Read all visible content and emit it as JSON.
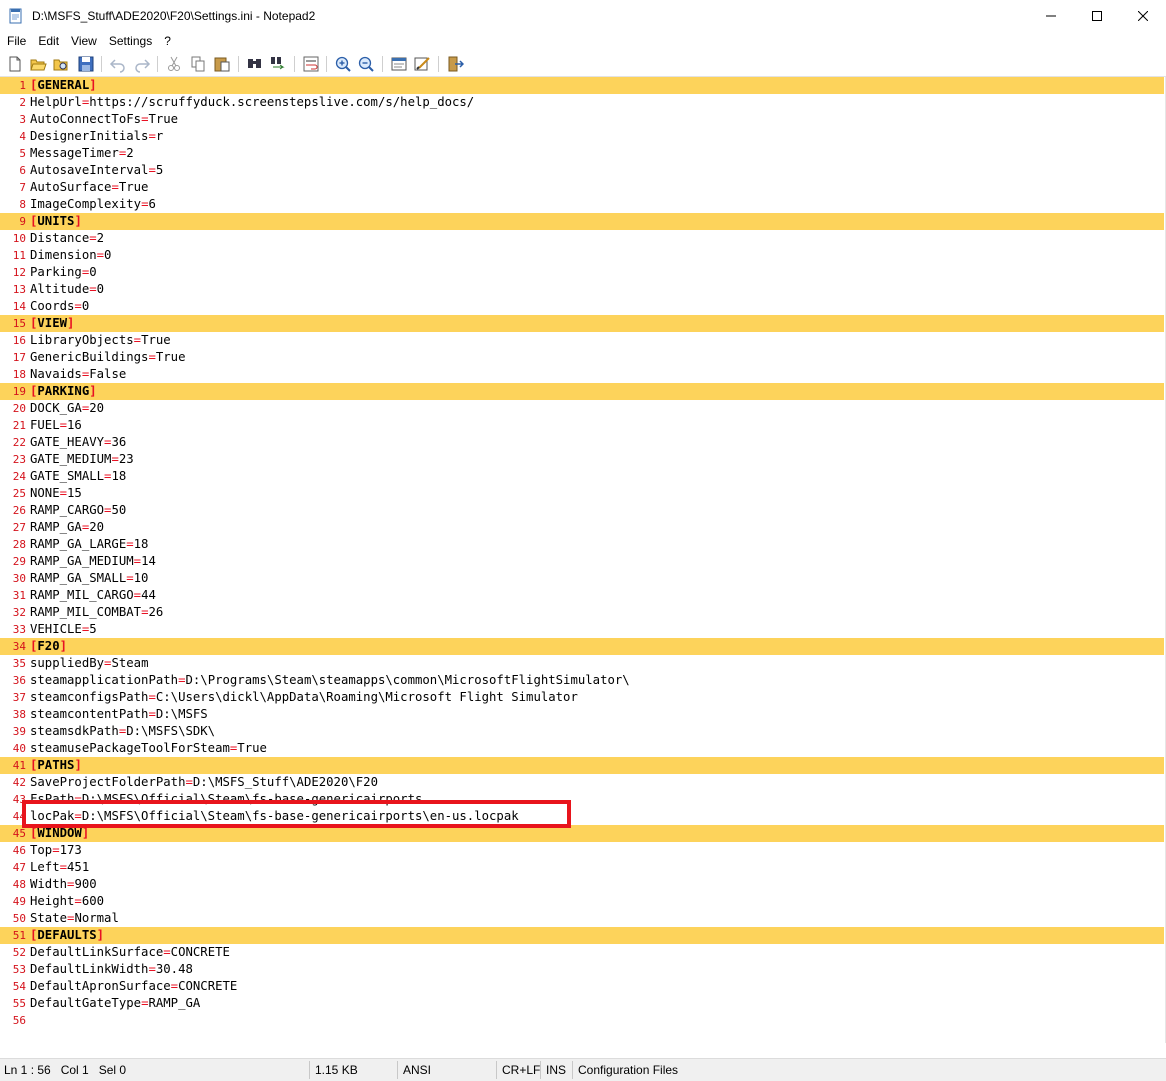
{
  "window": {
    "title": "D:\\MSFS_Stuff\\ADE2020\\F20\\Settings.ini - Notepad2",
    "minimize_label": "—",
    "maximize_label": "☐",
    "close_label": "✕"
  },
  "menu": {
    "items": [
      "File",
      "Edit",
      "View",
      "Settings",
      "?"
    ]
  },
  "toolbar": {
    "icons": [
      "new-icon",
      "open-icon",
      "browse-icon",
      "save-icon",
      "undo-icon",
      "redo-icon",
      "cut-icon",
      "copy-icon",
      "paste-icon",
      "find-icon",
      "replace-icon",
      "wordwrap-icon",
      "zoom-in-icon",
      "zoom-out-icon",
      "scheme-icon",
      "customize-icon",
      "exit-icon"
    ]
  },
  "colors": {
    "section_bg": "#fdd35b",
    "line_number": "#d4121b",
    "equals": "#e81123",
    "highlight_border": "#e8141c"
  },
  "editor": {
    "lines": [
      {
        "n": "1",
        "type": "section",
        "name": "GENERAL"
      },
      {
        "n": "2",
        "type": "kv",
        "key": "HelpUrl",
        "value": "https://scruffyduck.screenstepslive.com/s/help_docs/"
      },
      {
        "n": "3",
        "type": "kv",
        "key": "AutoConnectToFs",
        "value": "True"
      },
      {
        "n": "4",
        "type": "kv",
        "key": "DesignerInitials",
        "value": "r"
      },
      {
        "n": "5",
        "type": "kv",
        "key": "MessageTimer",
        "value": "2"
      },
      {
        "n": "6",
        "type": "kv",
        "key": "AutosaveInterval",
        "value": "5"
      },
      {
        "n": "7",
        "type": "kv",
        "key": "AutoSurface",
        "value": "True"
      },
      {
        "n": "8",
        "type": "kv",
        "key": "ImageComplexity",
        "value": "6"
      },
      {
        "n": "9",
        "type": "section",
        "name": "UNITS"
      },
      {
        "n": "10",
        "type": "kv",
        "key": "Distance",
        "value": "2"
      },
      {
        "n": "11",
        "type": "kv",
        "key": "Dimension",
        "value": "0"
      },
      {
        "n": "12",
        "type": "kv",
        "key": "Parking",
        "value": "0"
      },
      {
        "n": "13",
        "type": "kv",
        "key": "Altitude",
        "value": "0"
      },
      {
        "n": "14",
        "type": "kv",
        "key": "Coords",
        "value": "0"
      },
      {
        "n": "15",
        "type": "section",
        "name": "VIEW"
      },
      {
        "n": "16",
        "type": "kv",
        "key": "LibraryObjects",
        "value": "True"
      },
      {
        "n": "17",
        "type": "kv",
        "key": "GenericBuildings",
        "value": "True"
      },
      {
        "n": "18",
        "type": "kv",
        "key": "Navaids",
        "value": "False"
      },
      {
        "n": "19",
        "type": "section",
        "name": "PARKING"
      },
      {
        "n": "20",
        "type": "kv",
        "key": "DOCK_GA",
        "value": "20"
      },
      {
        "n": "21",
        "type": "kv",
        "key": "FUEL",
        "value": "16"
      },
      {
        "n": "22",
        "type": "kv",
        "key": "GATE_HEAVY",
        "value": "36"
      },
      {
        "n": "23",
        "type": "kv",
        "key": "GATE_MEDIUM",
        "value": "23"
      },
      {
        "n": "24",
        "type": "kv",
        "key": "GATE_SMALL",
        "value": "18"
      },
      {
        "n": "25",
        "type": "kv",
        "key": "NONE",
        "value": "15"
      },
      {
        "n": "26",
        "type": "kv",
        "key": "RAMP_CARGO",
        "value": "50"
      },
      {
        "n": "27",
        "type": "kv",
        "key": "RAMP_GA",
        "value": "20"
      },
      {
        "n": "28",
        "type": "kv",
        "key": "RAMP_GA_LARGE",
        "value": "18"
      },
      {
        "n": "29",
        "type": "kv",
        "key": "RAMP_GA_MEDIUM",
        "value": "14"
      },
      {
        "n": "30",
        "type": "kv",
        "key": "RAMP_GA_SMALL",
        "value": "10"
      },
      {
        "n": "31",
        "type": "kv",
        "key": "RAMP_MIL_CARGO",
        "value": "44"
      },
      {
        "n": "32",
        "type": "kv",
        "key": "RAMP_MIL_COMBAT",
        "value": "26"
      },
      {
        "n": "33",
        "type": "kv",
        "key": "VEHICLE",
        "value": "5"
      },
      {
        "n": "34",
        "type": "section",
        "name": "F20"
      },
      {
        "n": "35",
        "type": "kv",
        "key": "suppliedBy",
        "value": "Steam"
      },
      {
        "n": "36",
        "type": "kv",
        "key": "steamapplicationPath",
        "value": "D:\\Programs\\Steam\\steamapps\\common\\MicrosoftFlightSimulator\\"
      },
      {
        "n": "37",
        "type": "kv",
        "key": "steamconfigsPath",
        "value": "C:\\Users\\dickl\\AppData\\Roaming\\Microsoft Flight Simulator"
      },
      {
        "n": "38",
        "type": "kv",
        "key": "steamcontentPath",
        "value": "D:\\MSFS"
      },
      {
        "n": "39",
        "type": "kv",
        "key": "steamsdkPath",
        "value": "D:\\MSFS\\SDK\\"
      },
      {
        "n": "40",
        "type": "kv",
        "key": "steamusePackageToolForSteam",
        "value": "True"
      },
      {
        "n": "41",
        "type": "section",
        "name": "PATHS"
      },
      {
        "n": "42",
        "type": "kv",
        "key": "SaveProjectFolderPath",
        "value": "D:\\MSFS_Stuff\\ADE2020\\F20"
      },
      {
        "n": "43",
        "type": "kv",
        "key": "FsPath",
        "value": "D:\\MSFS\\Official\\Steam\\fs-base-genericairports"
      },
      {
        "n": "44",
        "type": "kv",
        "key": "locPak",
        "value": "D:\\MSFS\\Official\\Steam\\fs-base-genericairports\\en-us.locpak"
      },
      {
        "n": "45",
        "type": "section",
        "name": "WINDOW"
      },
      {
        "n": "46",
        "type": "kv",
        "key": "Top",
        "value": "173"
      },
      {
        "n": "47",
        "type": "kv",
        "key": "Left",
        "value": "451"
      },
      {
        "n": "48",
        "type": "kv",
        "key": "Width",
        "value": "900"
      },
      {
        "n": "49",
        "type": "kv",
        "key": "Height",
        "value": "600"
      },
      {
        "n": "50",
        "type": "kv",
        "key": "State",
        "value": "Normal"
      },
      {
        "n": "51",
        "type": "section",
        "name": "DEFAULTS"
      },
      {
        "n": "52",
        "type": "kv",
        "key": "DefaultLinkSurface",
        "value": "CONCRETE"
      },
      {
        "n": "53",
        "type": "kv",
        "key": "DefaultLinkWidth",
        "value": "30.48"
      },
      {
        "n": "54",
        "type": "kv",
        "key": "DefaultApronSurface",
        "value": "CONCRETE"
      },
      {
        "n": "55",
        "type": "kv",
        "key": "DefaultGateType",
        "value": "RAMP_GA"
      },
      {
        "n": "56",
        "type": "empty"
      }
    ]
  },
  "status": {
    "position": "Ln 1 : 56   Col 1   Sel 0",
    "size": "1.15 KB",
    "encoding": "ANSI",
    "eol": "CR+LF",
    "mode": "INS",
    "scheme": "Configuration Files"
  }
}
